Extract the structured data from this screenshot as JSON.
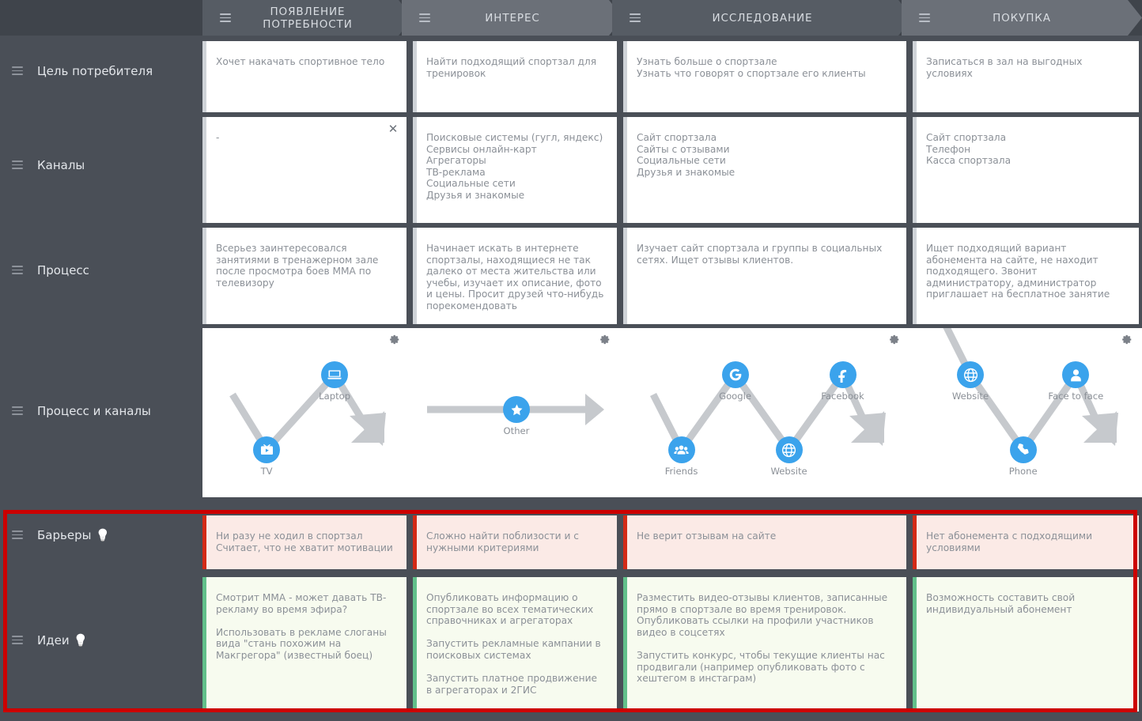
{
  "stages": [
    {
      "label": "ПОЯВЛЕНИЕ ПОТРЕБНОСТИ",
      "menu_icon": "hamburger-icon"
    },
    {
      "label": "ИНТЕРЕС",
      "menu_icon": "hamburger-icon"
    },
    {
      "label": "ИССЛЕДОВАНИЕ",
      "menu_icon": "hamburger-icon"
    },
    {
      "label": "ПОКУПКА",
      "menu_icon": "hamburger-icon"
    }
  ],
  "rows": [
    {
      "key": "goal",
      "label": "Цель потребителя",
      "bulb": ""
    },
    {
      "key": "channels",
      "label": "Каналы",
      "bulb": ""
    },
    {
      "key": "process",
      "label": "Процесс",
      "bulb": ""
    },
    {
      "key": "flow",
      "label": "Процесс и каналы",
      "bulb": ""
    },
    {
      "key": "barriers",
      "label": "Барьеры",
      "bulb": "💡"
    },
    {
      "key": "ideas",
      "label": "Идеи",
      "bulb": "💡"
    }
  ],
  "cells": {
    "goal": [
      "Хочет накачать спортивное тело",
      "Найти подходящий спортзал для тренировок",
      "Узнать больше о спортзале\nУзнать что говорят о спортзале его клиенты",
      "Записаться в зал на выгодных условиях"
    ],
    "channels": [
      "-",
      "Поисковые системы (гугл, яндекс)\nСервисы онлайн-карт\nАгрегаторы\nТВ-реклама\nСоциальные сети\nДрузья и знакомые",
      "Сайт спортзала\nСайты с отзывами\nСоциальные сети\nДрузья и знакомые",
      "Сайт спортзала\nТелефон\nКасса спортзала"
    ],
    "process": [
      "Всерьез заинтересовался занятиями в тренажерном зале после просмотра боев ММА по телевизору",
      "Начинает искать в интернете спортзалы, находящиеся не так далеко от места жительства или учебы, изучает их описание, фото и цены. Просит друзей что-нибудь порекомендовать",
      "Изучает сайт спортзала и группы в социальных сетях. Ищет отзывы клиентов.",
      "Ищет подходящий вариант абонемента на сайте, не находит подходящего. Звонит администратору, администратор приглашает на бесплатное занятие"
    ],
    "barriers": [
      "Ни разу не ходил в спортзал\nСчитает, что не хватит мотивации",
      "Сложно найти поблизости и с нужными критериями",
      "Не верит отзывам на сайте",
      "Нет абонемента с подходящими условиями"
    ],
    "ideas": [
      "Смотрит ММА - может давать ТВ-рекламу во время эфира?\n\nИспользовать в рекламе слоганы вида \"стань похожим на Макгрегора\" (известный боец)",
      "Опубликовать информацию о спортзале во всех тематических справочниках и агрегаторах\n\nЗапустить рекламные кампании в поисковых системах\n\nЗапустить платное продвижение в агрегаторах и 2ГИС",
      "Разместить видео-отзывы клиентов, записанные прямо в спортзале во время тренировок. Опубликовать ссылки на профили участников видео в соцсетях\n\nЗапустить конкурс, чтобы текущие клиенты нас продвигали (например опубликовать фото с хештегом в инстаграм)",
      "Возможность составить свой индивидуальный абонемент"
    ]
  },
  "flow": {
    "settings_icon": "gear-icon",
    "panels": [
      {
        "nodes": [
          {
            "label": "TV",
            "icon": "tv-icon",
            "level": "low"
          },
          {
            "label": "Laptop",
            "icon": "laptop-icon",
            "level": "high"
          }
        ]
      },
      {
        "nodes": [
          {
            "label": "Other",
            "icon": "star-icon",
            "level": "mid"
          }
        ]
      },
      {
        "nodes": [
          {
            "label": "Friends",
            "icon": "friends-icon",
            "level": "low"
          },
          {
            "label": "Google",
            "icon": "google-icon",
            "level": "high"
          },
          {
            "label": "Website",
            "icon": "globe-icon",
            "level": "low"
          },
          {
            "label": "Facebook",
            "icon": "facebook-icon",
            "level": "high"
          }
        ]
      },
      {
        "nodes": [
          {
            "label": "Website",
            "icon": "globe-icon",
            "level": "high"
          },
          {
            "label": "Phone",
            "icon": "phone-icon",
            "level": "low"
          },
          {
            "label": "Face to face",
            "icon": "person-icon",
            "level": "high"
          }
        ]
      }
    ]
  },
  "close_button": {
    "glyph": "✕",
    "name": "close-icon"
  },
  "colors": {
    "canvas": "#4a4f57",
    "header": "#3f444b",
    "stage_active": "#6b7078",
    "card": "#ffffff",
    "card_accent": "#cfd3d8",
    "barrier_bg": "#fbeae6",
    "barrier_accent": "#d32a16",
    "idea_bg": "#f7fbef",
    "idea_accent": "#62c08a",
    "node": "#3ba3ec",
    "connector": "#c6c9cd",
    "selection": "#cc0000",
    "text": "#8b9097"
  }
}
